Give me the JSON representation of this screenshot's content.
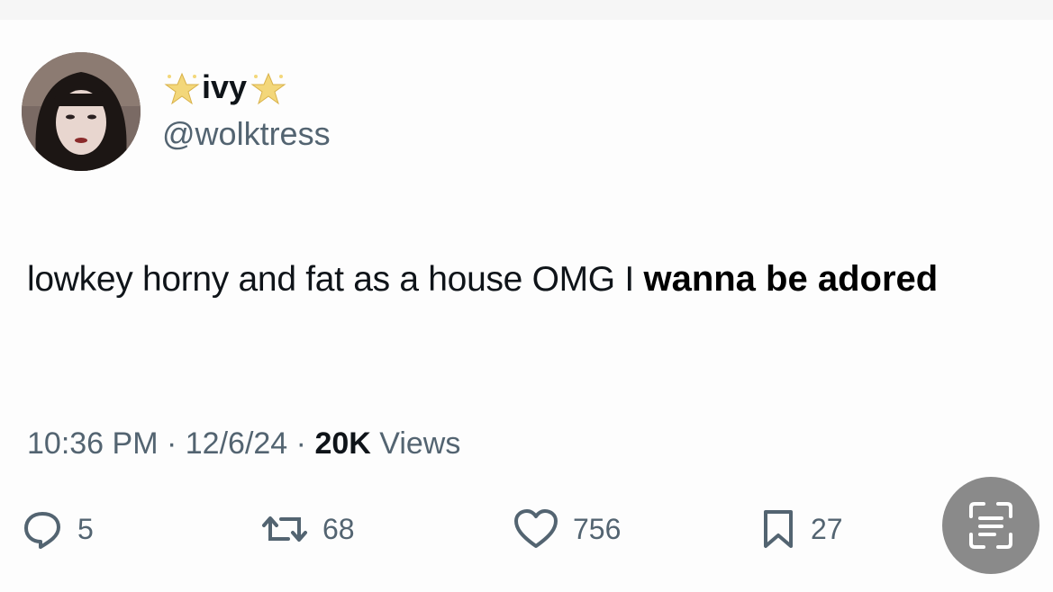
{
  "user": {
    "display_name": "ivy",
    "handle": "@wolktress",
    "avatar_icon": "profile-photo-icon",
    "name_decoration_icon": "star-emoji-icon"
  },
  "tweet": {
    "text_regular": "lowkey horny and fat as a house OMG I ",
    "text_bold": "wanna be adored"
  },
  "meta": {
    "time": "10:36 PM",
    "separator": "·",
    "date": "12/6/24",
    "views_count": "20K",
    "views_label": "Views"
  },
  "actions": {
    "reply": {
      "icon": "reply-icon",
      "count": "5"
    },
    "retweet": {
      "icon": "retweet-icon",
      "count": "68"
    },
    "like": {
      "icon": "heart-icon",
      "count": "756"
    },
    "bookmark": {
      "icon": "bookmark-icon",
      "count": "27"
    }
  },
  "overlay": {
    "icon": "text-scan-icon"
  },
  "colors": {
    "text_primary": "#0f1419",
    "text_secondary": "#536471",
    "background": "#fdfdfd",
    "star": "#f3d77a",
    "scan_button": "#8a8a8a"
  }
}
